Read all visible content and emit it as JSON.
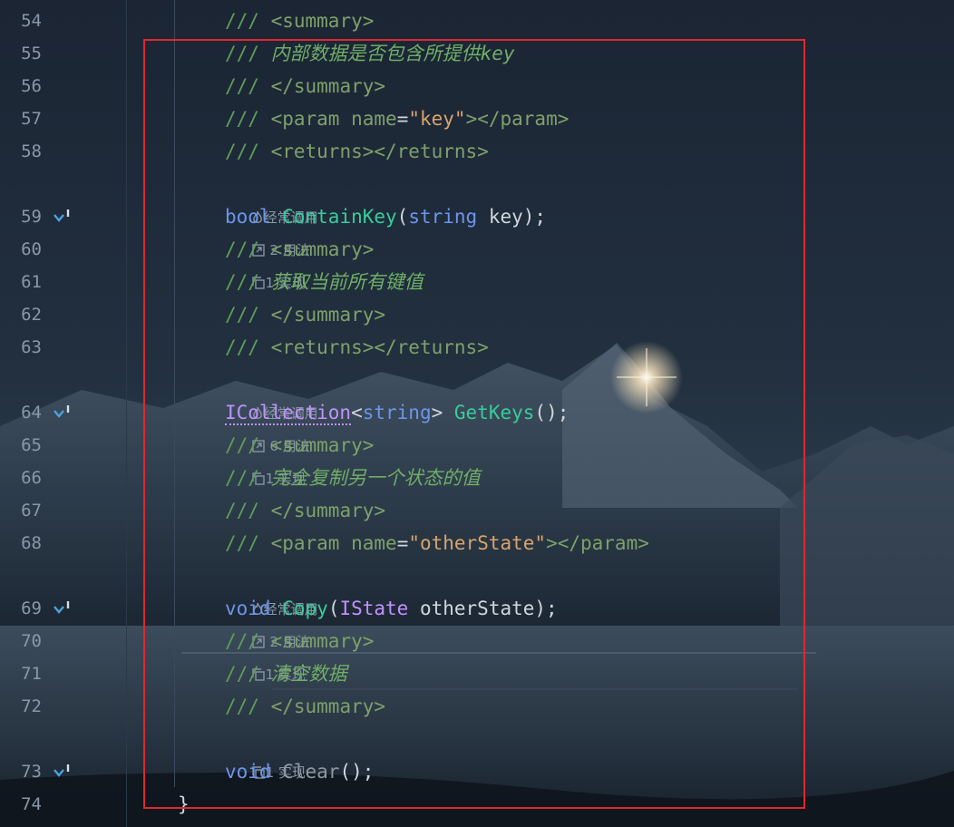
{
  "hints": {
    "frequently_called": "经常调用",
    "implementations": "1 实现"
  },
  "lines": [
    {
      "num": "54",
      "comment": "///",
      "open": "<summary>"
    },
    {
      "num": "55",
      "comment": "///",
      "text": "内部数据是否包含所提供key"
    },
    {
      "num": "56",
      "comment": "///",
      "close": "</summary>"
    },
    {
      "num": "57",
      "comment": "///",
      "param_open": "<param",
      "attr": "name",
      "eq": "=",
      "value": "\"key\"",
      "param_close": "></param>"
    },
    {
      "num": "58",
      "comment": "///",
      "returns": "<returns></returns>"
    },
    {
      "hint_usages": "2 用法"
    },
    {
      "num": "59",
      "kw": "bool",
      "fn": "ContainKey",
      "p1": "(",
      "ptype": "string",
      "p2": " key);"
    },
    {
      "num": "60",
      "comment": "///",
      "open": "<summary>"
    },
    {
      "num": "61",
      "comment": "///",
      "text": "获取当前所有键值"
    },
    {
      "num": "62",
      "comment": "///",
      "close": "</summary>"
    },
    {
      "num": "63",
      "comment": "///",
      "returns": "<returns></returns>"
    },
    {
      "hint_usages": "6 用法"
    },
    {
      "num": "64",
      "type": "ICollection",
      "lt": "<",
      "ptype": "string",
      "gt": ">",
      "fn": "GetKeys",
      "p2": "();"
    },
    {
      "num": "65",
      "comment": "///",
      "open": "<summary>"
    },
    {
      "num": "66",
      "comment": "///",
      "text": "完全复制另一个状态的值"
    },
    {
      "num": "67",
      "comment": "///",
      "close": "</summary>"
    },
    {
      "num": "68",
      "comment": "///",
      "param_open": "<param",
      "attr": "name",
      "eq": "=",
      "value": "\"otherState\"",
      "param_close": "></param>"
    },
    {
      "hint_usages": "2 用法"
    },
    {
      "num": "69",
      "kw": "void",
      "fn": "Copy",
      "p1": "(",
      "type": "IState",
      "p2": " otherState);"
    },
    {
      "num": "70",
      "comment": "///",
      "open": "<summary>"
    },
    {
      "num": "71",
      "comment": "///",
      "text": "清空数据"
    },
    {
      "num": "72",
      "comment": "///",
      "close": "</summary>"
    },
    {
      "hint_impl_only": "1 实现"
    },
    {
      "num": "73",
      "kw": "void",
      "fn": "Clear",
      "p2": "();"
    },
    {
      "num": "74",
      "brace": "}"
    }
  ],
  "colors": {
    "accent_selection": "#e0282e",
    "keyword": "#6c95eb",
    "function": "#39cc9b",
    "type": "#c191ff",
    "comment": "#5e9f5a",
    "string": "#d9a36c"
  },
  "icons": {
    "frequent": "flame-icon",
    "usages": "arrow-out-icon",
    "impl": "implementations-icon",
    "gutter": "implemented-down-arrow-icon"
  }
}
